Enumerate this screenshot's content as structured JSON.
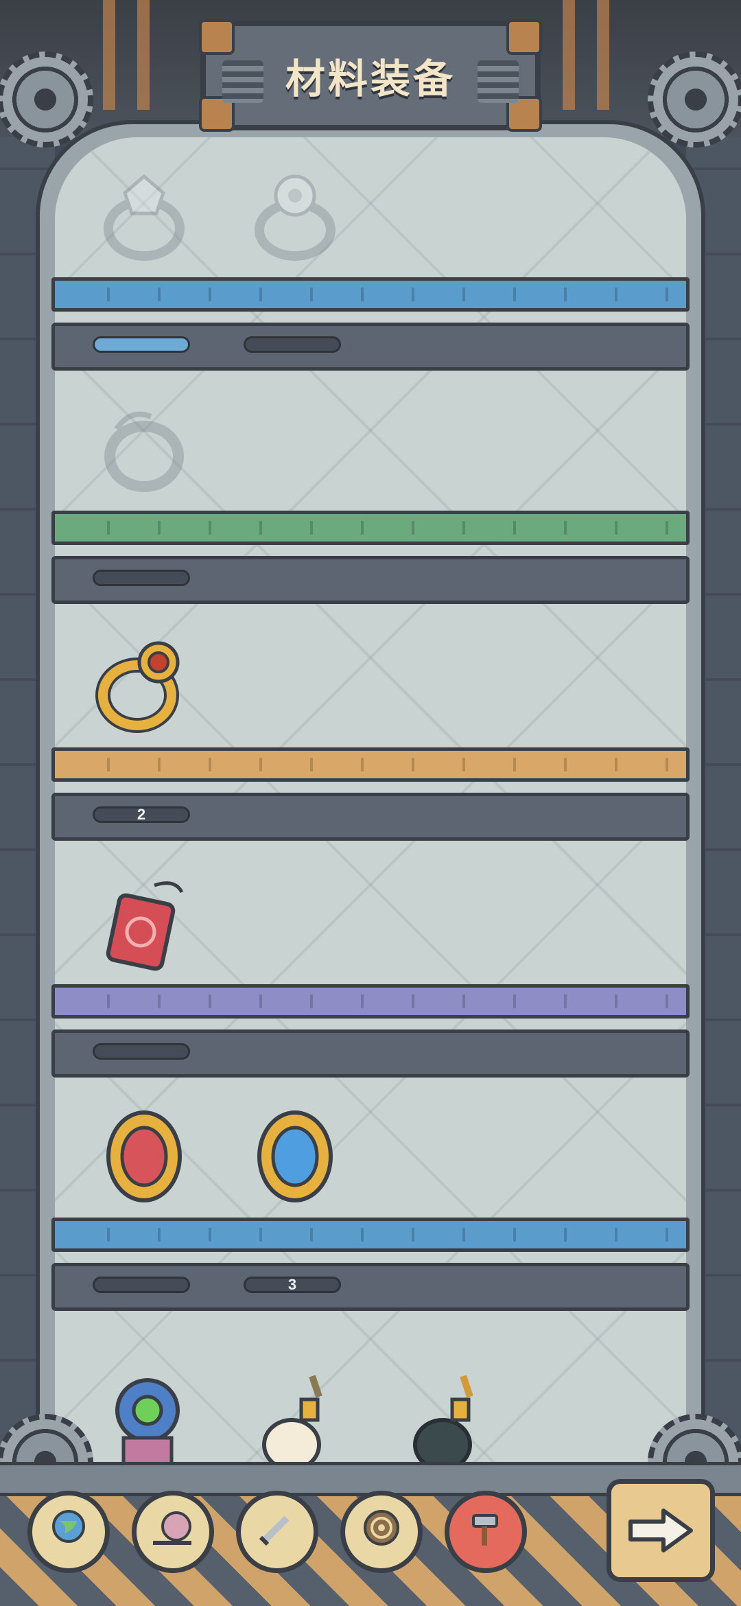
{
  "title": "材料装备",
  "shelves": [
    {
      "color": "#5a9ccc",
      "items": [
        {
          "icon": "crystal-ring-icon",
          "locked": true
        },
        {
          "icon": "flower-ring-icon",
          "locked": true
        }
      ],
      "gauges": [
        {
          "fill": 1.0,
          "label": ""
        },
        {
          "fill": 0.0,
          "label": ""
        }
      ]
    },
    {
      "color": "#6aaa7d",
      "items": [
        {
          "icon": "claw-ring-icon",
          "locked": true
        }
      ],
      "gauges": [
        {
          "fill": 0.0,
          "label": ""
        }
      ]
    },
    {
      "color": "#d9a869",
      "items": [
        {
          "icon": "ruby-ring-icon",
          "locked": false
        }
      ],
      "gauges": [
        {
          "fill": 0.0,
          "label": "2"
        }
      ]
    },
    {
      "color": "#8f8dc6",
      "items": [
        {
          "icon": "red-amulet-icon",
          "locked": false
        }
      ],
      "gauges": [
        {
          "fill": 0.0,
          "label": ""
        }
      ]
    },
    {
      "color": "#5a9ccc",
      "items": [
        {
          "icon": "red-mirror-icon",
          "locked": false
        },
        {
          "icon": "blue-mirror-icon",
          "locked": false
        }
      ],
      "gauges": [
        {
          "fill": 0.0,
          "label": ""
        },
        {
          "fill": 0.0,
          "label": "3"
        }
      ]
    }
  ],
  "bottom_row_items": [
    {
      "icon": "flower-gem-ring-icon"
    },
    {
      "icon": "pearl-pendant-icon"
    },
    {
      "icon": "dark-pearl-pendant-icon"
    }
  ],
  "nav": [
    {
      "icon": "globe-icon",
      "active": false
    },
    {
      "icon": "snail-icon",
      "active": false
    },
    {
      "icon": "sword-icon",
      "active": false
    },
    {
      "icon": "spiral-icon",
      "active": false
    },
    {
      "icon": "hammer-icon",
      "active": true
    }
  ],
  "next_button": {
    "icon": "arrow-right-icon"
  }
}
